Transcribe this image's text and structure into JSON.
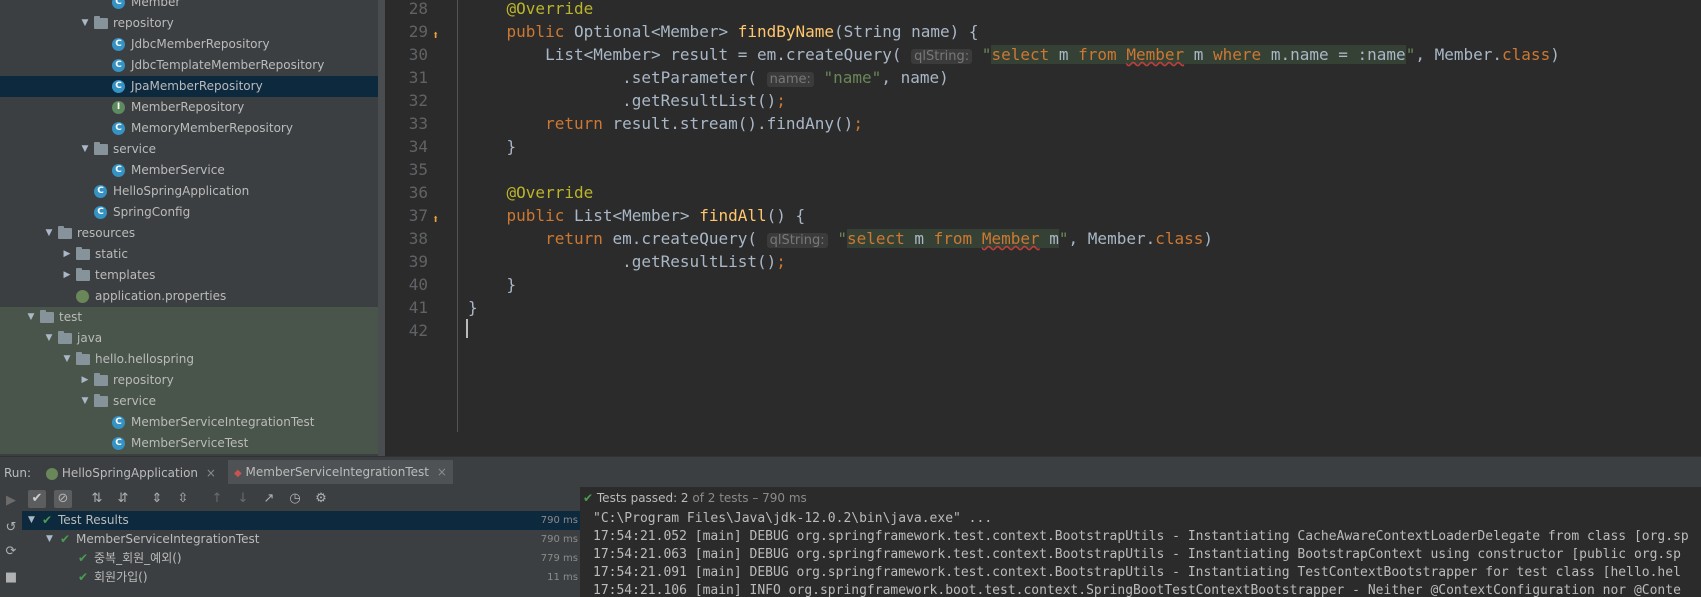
{
  "project_tree": {
    "items": [
      {
        "label": "Member",
        "kind": "class",
        "depth": 6,
        "arrow": ""
      },
      {
        "label": "repository",
        "kind": "folder",
        "depth": 5,
        "arrow": "▼"
      },
      {
        "label": "JdbcMemberRepository",
        "kind": "class",
        "depth": 6,
        "arrow": ""
      },
      {
        "label": "JdbcTemplateMemberRepository",
        "kind": "class",
        "depth": 6,
        "arrow": ""
      },
      {
        "label": "JpaMemberRepository",
        "kind": "class",
        "depth": 6,
        "arrow": "",
        "selected": true
      },
      {
        "label": "MemberRepository",
        "kind": "interface",
        "depth": 6,
        "arrow": ""
      },
      {
        "label": "MemoryMemberRepository",
        "kind": "class",
        "depth": 6,
        "arrow": ""
      },
      {
        "label": "service",
        "kind": "folder",
        "depth": 5,
        "arrow": "▼"
      },
      {
        "label": "MemberService",
        "kind": "class",
        "depth": 6,
        "arrow": ""
      },
      {
        "label": "HelloSpringApplication",
        "kind": "class",
        "depth": 5,
        "arrow": ""
      },
      {
        "label": "SpringConfig",
        "kind": "class",
        "depth": 5,
        "arrow": ""
      },
      {
        "label": "resources",
        "kind": "folder",
        "depth": 3,
        "arrow": "▼"
      },
      {
        "label": "static",
        "kind": "folder",
        "depth": 4,
        "arrow": "▶"
      },
      {
        "label": "templates",
        "kind": "folder",
        "depth": 4,
        "arrow": "▶"
      },
      {
        "label": "application.properties",
        "kind": "props",
        "depth": 4,
        "arrow": ""
      },
      {
        "label": "test",
        "kind": "folder",
        "depth": 2,
        "arrow": "▼",
        "test": true
      },
      {
        "label": "java",
        "kind": "folder",
        "depth": 3,
        "arrow": "▼",
        "test": true
      },
      {
        "label": "hello.hellospring",
        "kind": "folder",
        "depth": 4,
        "arrow": "▼",
        "test": true
      },
      {
        "label": "repository",
        "kind": "folder",
        "depth": 5,
        "arrow": "▶",
        "test": true
      },
      {
        "label": "service",
        "kind": "folder",
        "depth": 5,
        "arrow": "▼",
        "test": true
      },
      {
        "label": "MemberServiceIntegrationTest",
        "kind": "class",
        "depth": 6,
        "arrow": "",
        "test": true
      },
      {
        "label": "MemberServiceTest",
        "kind": "class",
        "depth": 6,
        "arrow": "",
        "test": true
      }
    ]
  },
  "editor": {
    "lines": [
      {
        "n": "28",
        "html": "    <span class='ann'>@Override</span>"
      },
      {
        "n": "29",
        "html": "    <span class='kw'>public</span> Optional&lt;Member&gt; <span class='fn'>findByName</span>(String name) {",
        "mark": "impl"
      },
      {
        "n": "30",
        "html": "        List&lt;Member&gt; result = em.createQuery( <span class='hint'>qlString:</span> <span class='str'>\"</span><span class='sqlkw'>select</span><span class='sqlid'> m </span><span class='sqlkw'>from</span><span class='sqlid'> </span><span class='sqltbl'>Member</span><span class='sqlid'> m </span><span class='sqlkw'>where</span><span class='sqlid'> m.name = :name</span><span class='str'>\"</span>, Member.<span class='kw'>class</span>)"
      },
      {
        "n": "31",
        "html": "                .setParameter( <span class='hint'>name:</span> <span class='str'>\"name\"</span>, name)"
      },
      {
        "n": "32",
        "html": "                .getResultList()<span class='kw'>;</span>"
      },
      {
        "n": "33",
        "html": "        <span class='kw'>return</span> result.stream().findAny()<span class='kw'>;</span>"
      },
      {
        "n": "34",
        "html": "    }"
      },
      {
        "n": "35",
        "html": ""
      },
      {
        "n": "36",
        "html": "    <span class='ann'>@Override</span>"
      },
      {
        "n": "37",
        "html": "    <span class='kw'>public</span> List&lt;Member&gt; <span class='fn'>findAll</span>() {",
        "mark": "impl"
      },
      {
        "n": "38",
        "html": "        <span class='kw'>return</span> em.createQuery( <span class='hint'>qlString:</span> <span class='str'>\"</span><span class='sqlkw'>select</span><span class='sqlid'> m </span><span class='sqlkw'>from</span><span class='sqlid'> </span><span class='sqltbl'>Member</span><span class='sqlid'> m</span><span class='str'>\"</span>, Member.<span class='kw'>class</span>)"
      },
      {
        "n": "39",
        "html": "                .getResultList()<span class='kw'>;</span>"
      },
      {
        "n": "40",
        "html": "    }"
      },
      {
        "n": "41",
        "html": "}"
      },
      {
        "n": "42",
        "html": ""
      }
    ]
  },
  "run_panel": {
    "run_label": "Run:",
    "tabs": [
      {
        "label": "HelloSpringApplication",
        "close": "×"
      },
      {
        "label": "MemberServiceIntegrationTest",
        "close": "×"
      }
    ],
    "status": {
      "prefix": "Tests passed: ",
      "count": "2",
      "suffix": " of 2 tests – 790 ms"
    },
    "results": [
      {
        "label": "Test Results",
        "time": "790 ms",
        "indent": 0,
        "arrow": "▼",
        "selected": true
      },
      {
        "label": "MemberServiceIntegrationTest",
        "time": "790 ms",
        "indent": 1,
        "arrow": "▼"
      },
      {
        "label": "중복_회원_예외()",
        "time": "779 ms",
        "indent": 2,
        "arrow": ""
      },
      {
        "label": "회원가입()",
        "time": "11 ms",
        "indent": 2,
        "arrow": ""
      }
    ],
    "console": [
      "\"C:\\Program Files\\Java\\jdk-12.0.2\\bin\\java.exe\" ...",
      "17:54:21.052 [main] DEBUG org.springframework.test.context.BootstrapUtils - Instantiating CacheAwareContextLoaderDelegate from class [org.sp",
      "17:54:21.063 [main] DEBUG org.springframework.test.context.BootstrapUtils - Instantiating BootstrapContext using constructor [public org.sp",
      "17:54:21.091 [main] DEBUG org.springframework.test.context.BootstrapUtils - Instantiating TestContextBootstrapper for test class [hello.hel",
      "17:54:21.106 [main] INFO org.springframework.boot.test.context.SpringBootTestContextBootstrapper - Neither @ContextConfiguration nor @Conte"
    ]
  },
  "colors": {
    "accent": "#499c54",
    "selection": "#0d293e",
    "background": "#2b2b2b"
  }
}
